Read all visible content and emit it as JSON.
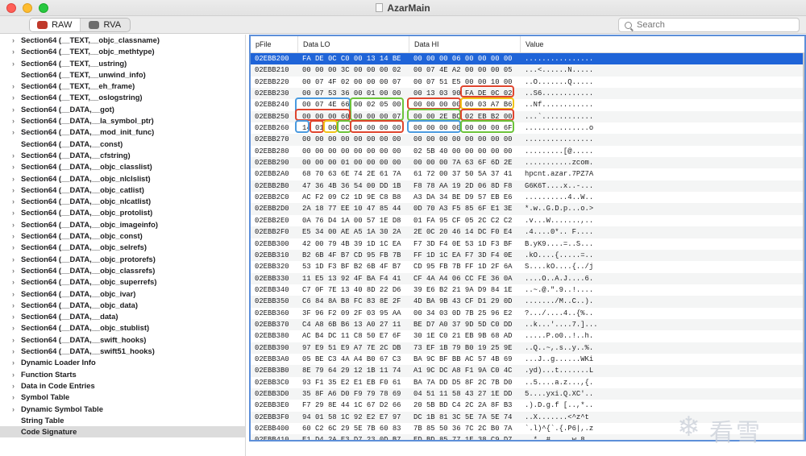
{
  "window": {
    "title": "AzarMain"
  },
  "toolbar": {
    "raw_label": "RAW",
    "rva_label": "RVA",
    "search_placeholder": "Search"
  },
  "sidebar": {
    "items": [
      {
        "label": "Section64 (__TEXT,__objc_classname)",
        "expandable": true
      },
      {
        "label": "Section64 (__TEXT,__objc_methtype)",
        "expandable": true
      },
      {
        "label": "Section64 (__TEXT,__ustring)",
        "expandable": true
      },
      {
        "label": "Section64 (__TEXT,__unwind_info)",
        "expandable": false
      },
      {
        "label": "Section64 (__TEXT,__eh_frame)",
        "expandable": true
      },
      {
        "label": "Section64 (__TEXT,__oslogstring)",
        "expandable": true
      },
      {
        "label": "Section64 (__DATA,__got)",
        "expandable": true
      },
      {
        "label": "Section64 (__DATA,__la_symbol_ptr)",
        "expandable": true
      },
      {
        "label": "Section64 (__DATA,__mod_init_func)",
        "expandable": true
      },
      {
        "label": "Section64 (__DATA,__const)",
        "expandable": false
      },
      {
        "label": "Section64 (__DATA,__cfstring)",
        "expandable": true
      },
      {
        "label": "Section64 (__DATA,__objc_classlist)",
        "expandable": true
      },
      {
        "label": "Section64 (__DATA,__objc_nlclslist)",
        "expandable": true
      },
      {
        "label": "Section64 (__DATA,__objc_catlist)",
        "expandable": true
      },
      {
        "label": "Section64 (__DATA,__objc_nlcatlist)",
        "expandable": true
      },
      {
        "label": "Section64 (__DATA,__objc_protolist)",
        "expandable": true
      },
      {
        "label": "Section64 (__DATA,__objc_imageinfo)",
        "expandable": true
      },
      {
        "label": "Section64 (__DATA,__objc_const)",
        "expandable": true
      },
      {
        "label": "Section64 (__DATA,__objc_selrefs)",
        "expandable": true
      },
      {
        "label": "Section64 (__DATA,__objc_protorefs)",
        "expandable": true
      },
      {
        "label": "Section64 (__DATA,__objc_classrefs)",
        "expandable": true
      },
      {
        "label": "Section64 (__DATA,__objc_superrefs)",
        "expandable": true
      },
      {
        "label": "Section64 (__DATA,__objc_ivar)",
        "expandable": true
      },
      {
        "label": "Section64 (__DATA,__objc_data)",
        "expandable": true
      },
      {
        "label": "Section64 (__DATA,__data)",
        "expandable": true
      },
      {
        "label": "Section64 (__DATA,__objc_stublist)",
        "expandable": true
      },
      {
        "label": "Section64 (__DATA,__swift_hooks)",
        "expandable": true
      },
      {
        "label": "Section64 (__DATA,__swift51_hooks)",
        "expandable": true
      },
      {
        "label": "Dynamic Loader Info",
        "expandable": true
      },
      {
        "label": "Function Starts",
        "expandable": true
      },
      {
        "label": "Data in Code Entries",
        "expandable": true
      },
      {
        "label": "Symbol Table",
        "expandable": true
      },
      {
        "label": "Dynamic Symbol Table",
        "expandable": true
      },
      {
        "label": "String Table",
        "expandable": false
      },
      {
        "label": "Code Signature",
        "expandable": false
      }
    ]
  },
  "table": {
    "columns": [
      "pFile",
      "Data LO",
      "Data HI",
      "Value"
    ],
    "rows": [
      [
        "02EBB200",
        "FA DE 0C C0 00 13 14 BE",
        "00 00 00 06 00 00 00 00",
        "................"
      ],
      [
        "02EBB210",
        "00 00 00 3C 00 00 00 02",
        "00 07 4E A2 00 00 00 05",
        "...<......N....."
      ],
      [
        "02EBB220",
        "00 07 4F 02 00 00 00 07",
        "00 07 51 E5 00 00 10 00",
        "..O.......Q....."
      ],
      [
        "02EBB230",
        "00 07 53 36 00 01 00 00",
        "00 13 03 90 FA DE 0C 02",
        "..S6............"
      ],
      [
        "02EBB240",
        "00 07 4E 66 00 02 05 00",
        "00 00 00 00 00 03 A7 B6",
        "..Nf............"
      ],
      [
        "02EBB250",
        "00 00 00 60 00 00 00 07",
        "00 00 2E BC 02 EB B2 00",
        "...`............"
      ],
      [
        "02EBB260",
        "14 01 00 0C 00 00 00 00",
        "00 00 00 00 00 00 00 6F",
        "...............o"
      ],
      [
        "02EBB270",
        "00 00 00 00 00 00 00 00",
        "00 00 00 00 00 00 00 00",
        "................"
      ],
      [
        "02EBB280",
        "00 00 00 00 00 00 00 00",
        "02 5B 40 00 00 00 00 00",
        ".........[@....."
      ],
      [
        "02EBB290",
        "00 00 00 01 00 00 00 00",
        "00 00 00 7A 63 6F 6D 2E",
        "...........zcom."
      ],
      [
        "02EBB2A0",
        "68 70 63 6E 74 2E 61 7A",
        "61 72 00 37 50 5A 37 41",
        "hpcnt.azar.7PZ7A"
      ],
      [
        "02EBB2B0",
        "47 36 4B 36 54 00 DD 1B",
        "F8 78 AA 19 2D 06 8D F8",
        "G6K6T....x..-..."
      ],
      [
        "02EBB2C0",
        "AC F2 09 C2 1D 9E C8 B8",
        "A3 DA 34 BE D9 57 EB E6",
        "..........4..W.."
      ],
      [
        "02EBB2D0",
        "2A 18 77 EE 10 47 85 44",
        "0D 70 A3 F5 85 6F E1 3E",
        "*.w..G.D.p...o.>"
      ],
      [
        "02EBB2E0",
        "0A 76 D4 1A 00 57 1E D8",
        "01 FA 95 CF 05 2C C2 C2",
        ".v...W.......,.."
      ],
      [
        "02EBB2F0",
        "E5 34 00 AE A5 1A 30 2A",
        "2E 0C 20 46 14 DC F0 E4",
        ".4....0*.. F...."
      ],
      [
        "02EBB300",
        "42 00 79 4B 39 1D 1C EA",
        "F7 3D F4 0E 53 1D F3 BF",
        "B.yK9....=..S..."
      ],
      [
        "02EBB310",
        "B2 6B 4F B7 CD 95 FB 7B",
        "FF 1D 1C EA F7 3D F4 0E",
        ".kO....{.....=.."
      ],
      [
        "02EBB320",
        "53 1D F3 BF B2 6B 4F B7",
        "CD 95 FB 7B FF 1D 2F 6A",
        "S....kO....{../j"
      ],
      [
        "02EBB330",
        "11 E5 13 92 4F BA F4 41",
        "CF 4A A4 06 CC FE 36 0A",
        "....O..A.J....6."
      ],
      [
        "02EBB340",
        "C7 0F 7E 13 40 8D 22 D6",
        "39 E6 B2 21 9A D9 84 1E",
        "..~.@.\".9..!...."
      ],
      [
        "02EBB350",
        "C6 84 8A B8 FC 83 8E 2F",
        "4D BA 9B 43 CF D1 29 0D",
        "......./M..C..)."
      ],
      [
        "02EBB360",
        "3F 96 F2 09 2F 03 95 AA",
        "00 34 03 0D 7B 25 96 E2",
        "?.../....4..{%.."
      ],
      [
        "02EBB370",
        "C4 A8 6B B6 13 A0 27 11",
        "BE D7 A0 37 9D 5D C0 DD",
        "..k...'....7.]..."
      ],
      [
        "02EBB380",
        "AC B4 DC 11 C8 50 E7 6F",
        "30 1E C0 21 EB 9B 68 AD",
        ".....P.o0..!..h."
      ],
      [
        "02EBB390",
        "97 E9 51 E9 A7 7E 2C DB",
        "73 EF 1B 79 B0 19 25 9E",
        "..Q..~,.s..y..%."
      ],
      [
        "02EBB3A0",
        "05 BE C3 4A A4 B0 67 C3",
        "BA 9C BF BB AC 57 4B 69",
        "...J..g......WKi"
      ],
      [
        "02EBB3B0",
        "8E 79 64 29 12 1B 11 74",
        "A1 9C DC A8 F1 9A C0 4C",
        ".yd)...t.......L"
      ],
      [
        "02EBB3C0",
        "93 F1 35 E2 E1 EB F0 61",
        "BA 7A DD D5 8F 2C 7B D0",
        "..5....a.z...,{."
      ],
      [
        "02EBB3D0",
        "35 8F A6 D0 F9 79 78 69",
        "04 51 11 58 43 27 1E DD",
        "5....yxi.Q.XC'.."
      ],
      [
        "02EBB3E0",
        "F7 29 8E 44 1C 67 D2 66",
        "20 5B BD C4 2C 2A 8F B3",
        ".).D.g.f [..,*.."
      ],
      [
        "02EBB3F0",
        "94 01 58 1C 92 E2 E7 97",
        "DC 1B 81 3C 5E 7A 5E 74",
        "..X.......<^z^t"
      ],
      [
        "02EBB400",
        "60 C2 6C 29 5E 7B 60 83",
        "7B 85 50 36 7C 2C B0 7A",
        "`.l)^{`.{.P6|,.z"
      ],
      [
        "02EBB410",
        "E1 D4 2A E3 D7 23 0D B7",
        "ED BD 85 77 1E 38 C9 D7",
        "..*..#.....w.8.."
      ]
    ]
  },
  "annotation_colors": {
    "red": "#e0452e",
    "blue": "#4a9be0",
    "green": "#6cc43a",
    "yellow": "#f0c419"
  },
  "watermark": {
    "text": "看雪",
    "icon": "snowflake-icon"
  }
}
